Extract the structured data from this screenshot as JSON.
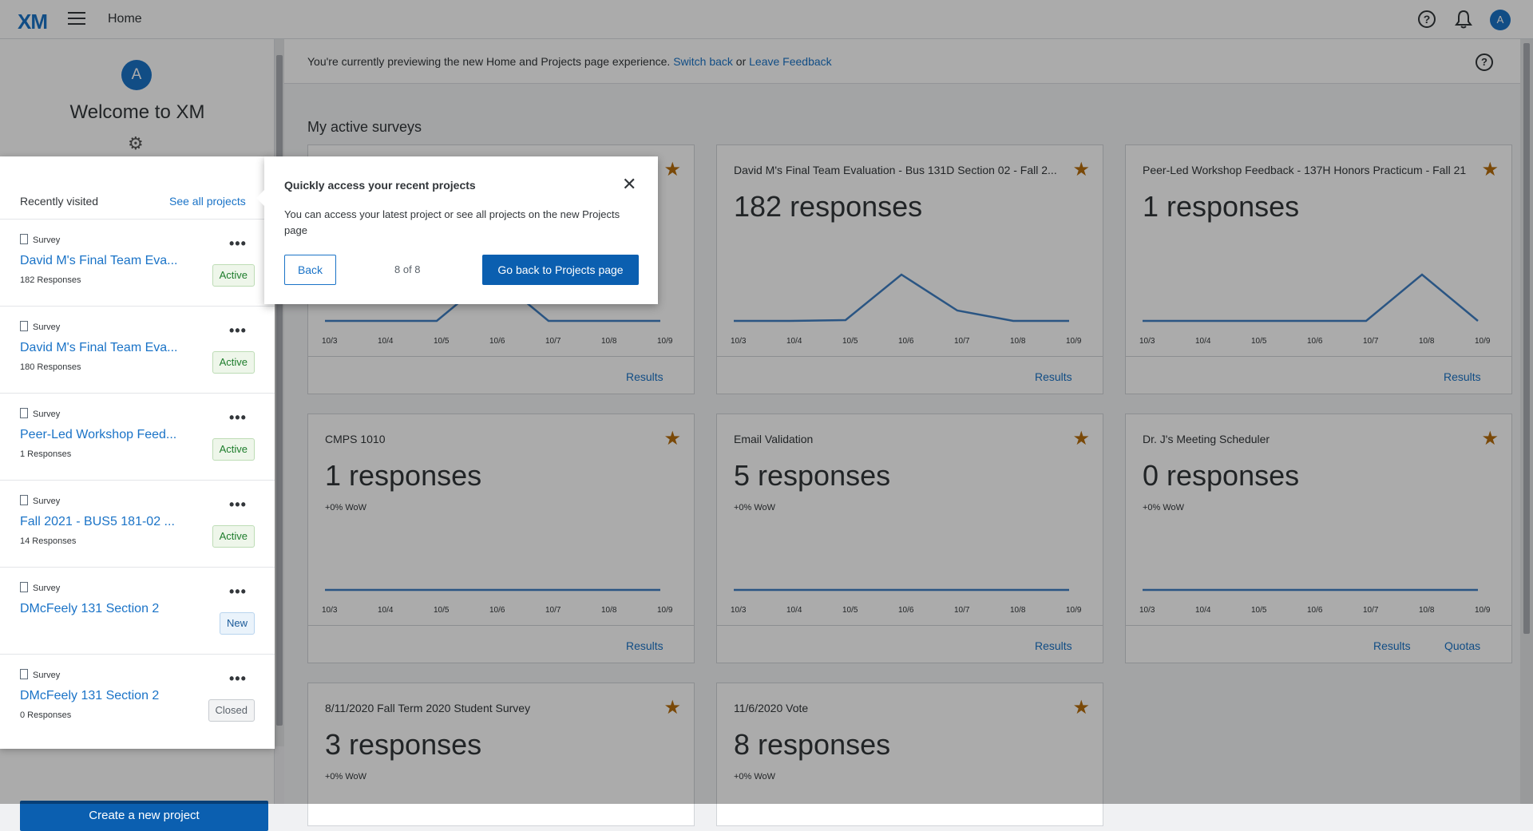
{
  "header": {
    "logo": "XM",
    "title": "Home",
    "help_glyph": "?",
    "avatar_initial": "A"
  },
  "sidebar": {
    "avatar_initial": "A",
    "welcome": "Welcome to XM",
    "create_button": "Create a new project"
  },
  "banner": {
    "text": "You're currently previewing the new Home and Projects page experience.",
    "switch_back": "Switch back",
    "or": "or",
    "leave_feedback": "Leave Feedback"
  },
  "main": {
    "section_title": "My active surveys"
  },
  "x_ticks": [
    "10/3",
    "10/4",
    "10/5",
    "10/6",
    "10/7",
    "10/8",
    "10/9"
  ],
  "cards": [
    {
      "title": "",
      "count": "",
      "wow": "",
      "links": [
        "Results"
      ],
      "series": [
        0,
        0,
        0,
        1,
        0,
        0,
        0
      ]
    },
    {
      "title": "David M's Final Team Evaluation - Bus 131D Section 02 - Fall 2...",
      "count": "182 responses",
      "wow": "",
      "links": [
        "Results"
      ],
      "series": [
        0,
        0,
        1,
        58,
        13,
        0,
        0
      ]
    },
    {
      "title": "Peer-Led Workshop Feedback - 137H Honors Practicum - Fall 21",
      "count": "1 responses",
      "wow": "",
      "links": [
        "Results"
      ],
      "series": [
        0,
        0,
        0,
        0,
        0,
        1,
        0
      ]
    },
    {
      "title": "CMPS 1010",
      "count": "1 responses",
      "wow": "+0% WoW",
      "links": [
        "Results"
      ],
      "series": [
        0,
        0,
        0,
        0,
        0,
        0,
        0
      ]
    },
    {
      "title": "Email Validation",
      "count": "5 responses",
      "wow": "+0% WoW",
      "links": [
        "Results"
      ],
      "series": [
        0,
        0,
        0,
        0,
        0,
        0,
        0
      ]
    },
    {
      "title": "Dr. J's Meeting Scheduler",
      "count": "0 responses",
      "wow": "+0% WoW",
      "links": [
        "Results",
        "Quotas"
      ],
      "series": [
        0,
        0,
        0,
        0,
        0,
        0,
        0
      ]
    },
    {
      "title": "8/11/2020 Fall Term 2020 Student Survey",
      "count": "3 responses",
      "wow": "+0% WoW",
      "links": [],
      "series": []
    },
    {
      "title": "11/6/2020 Vote",
      "count": "8 responses",
      "wow": "+0% WoW",
      "links": [],
      "series": []
    }
  ],
  "recent": {
    "heading": "Recently visited",
    "see_all": "See all projects",
    "items": [
      {
        "type": "Survey",
        "name": "David M's Final Team Eva...",
        "responses": "182 Responses",
        "status": "Active"
      },
      {
        "type": "Survey",
        "name": "David M's Final Team Eva...",
        "responses": "180 Responses",
        "status": "Active"
      },
      {
        "type": "Survey",
        "name": "Peer-Led Workshop Feed...",
        "responses": "1 Responses",
        "status": "Active"
      },
      {
        "type": "Survey",
        "name": "Fall 2021 - BUS5 181-02 ...",
        "responses": "14 Responses",
        "status": "Active"
      },
      {
        "type": "Survey",
        "name": "DMcFeely 131 Section 2",
        "responses": "",
        "status": "New"
      },
      {
        "type": "Survey",
        "name": "DMcFeely 131 Section 2",
        "responses": "0 Responses",
        "status": "Closed"
      }
    ]
  },
  "popover": {
    "title": "Quickly access your recent projects",
    "body": "You can access your latest project or see all projects on the new Projects page",
    "back": "Back",
    "step": "8 of 8",
    "primary": "Go back to Projects page"
  },
  "colors": {
    "accent": "#1a73c7",
    "primary_button": "#0b5fb0",
    "star": "#b76e0d",
    "line": "#3f7fc4"
  }
}
